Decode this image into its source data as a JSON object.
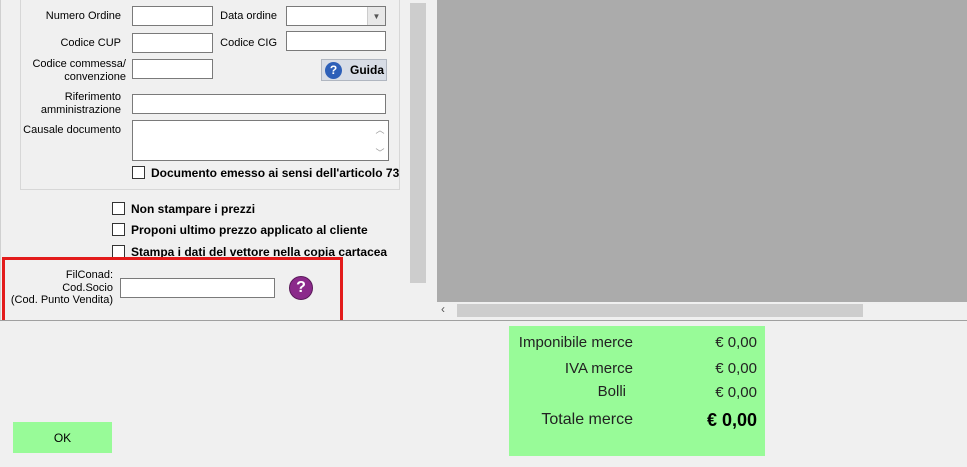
{
  "form": {
    "numero_ordine_label": "Numero Ordine",
    "numero_ordine_value": "",
    "data_ordine_label": "Data ordine",
    "data_ordine_value": "",
    "codice_cup_label": "Codice CUP",
    "codice_cup_value": "",
    "codice_cig_label": "Codice CIG",
    "codice_cig_value": "",
    "codice_commessa_label_1": "Codice commessa/",
    "codice_commessa_label_2": "convenzione",
    "codice_commessa_value": "",
    "guida_label": "Guida",
    "riferimento_label_1": "Riferimento",
    "riferimento_label_2": "amministrazione",
    "riferimento_value": "",
    "causale_label": "Causale documento",
    "causale_value": "",
    "art73_label": "Documento emesso ai sensi dell'articolo 73"
  },
  "options": {
    "non_stampare_label": "Non stampare i prezzi",
    "proponi_label": "Proponi ultimo prezzo applicato al cliente",
    "stampa_vettore_label": "Stampa i dati del vettore nella copia cartacea"
  },
  "filconad": {
    "label_1": "FilConad:",
    "label_2": "Cod.Socio",
    "label_3": "(Cod. Punto Vendita)",
    "value": "",
    "help_glyph": "?"
  },
  "totals": {
    "imponibile_label": "Imponibile merce",
    "imponibile_value": "€ 0,00",
    "iva_label": "IVA merce",
    "iva_value": "€ 0,00",
    "bolli_label": "Bolli",
    "bolli_value": "€ 0,00",
    "totale_label": "Totale merce",
    "totale_value": "€ 0,00"
  },
  "buttons": {
    "ok_label": "OK"
  },
  "colors": {
    "green": "#98fb98",
    "highlight_red": "#e31b1b",
    "help_purple": "#8b2a8b"
  },
  "icons": {
    "guida": "help-circle-blue-icon",
    "filconad_help": "help-circle-purple-icon",
    "scroll_left": "chevron-left-icon"
  }
}
